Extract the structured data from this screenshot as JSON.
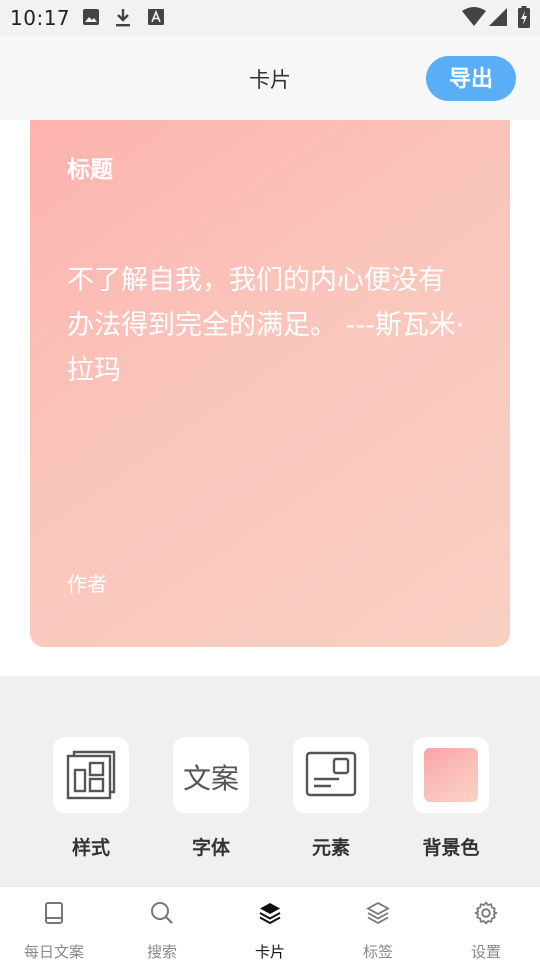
{
  "status_bar": {
    "time": "10:17",
    "icons": [
      "image-icon",
      "download-icon",
      "text-a-icon",
      "wifi-icon",
      "signal-icon",
      "battery-charging-icon"
    ]
  },
  "app_bar": {
    "title": "卡片",
    "export_label": "导出",
    "export_color": "#5aaef5"
  },
  "card": {
    "title": "标题",
    "quote": "不了解自我，我们的内心便没有办法得到完全的满足。 ---斯瓦米·拉玛",
    "author": "作者",
    "background_colors": [
      "#fdb2ae",
      "#f9cfc2"
    ]
  },
  "tools": [
    {
      "label": "样式",
      "icon": "layout-style-icon"
    },
    {
      "label": "字体",
      "icon_text": "文案"
    },
    {
      "label": "元素",
      "icon": "element-card-icon"
    },
    {
      "label": "背景色",
      "icon": "color-swatch-icon"
    }
  ],
  "bottom_nav": [
    {
      "label": "每日文案",
      "icon": "book-icon",
      "active": false
    },
    {
      "label": "搜索",
      "icon": "search-icon",
      "active": false
    },
    {
      "label": "卡片",
      "icon": "layers-icon",
      "active": true
    },
    {
      "label": "标签",
      "icon": "layers-outline-icon",
      "active": false
    },
    {
      "label": "设置",
      "icon": "gear-icon",
      "active": false
    }
  ]
}
